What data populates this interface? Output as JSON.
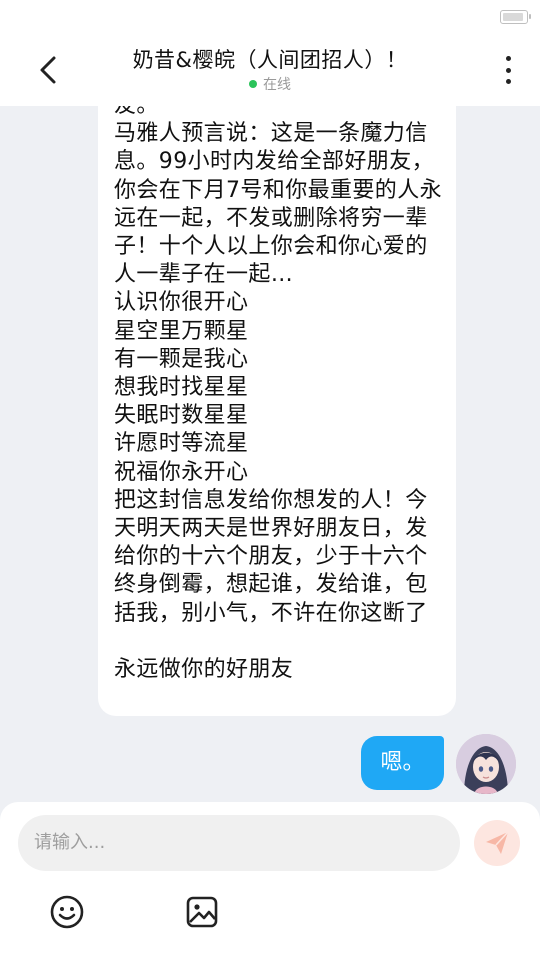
{
  "status_bar": {
    "battery_icon": "battery-icon"
  },
  "header": {
    "back_icon": "chevron-left-icon",
    "title": "奶昔&樱皖（人间团招人）！",
    "status": "在线",
    "status_color": "#2bc35a",
    "more_icon": "more-vertical-icon"
  },
  "messages": {
    "incoming_text": "友。\n马雅人预言说：这是一条魔力信息。99小时内发给全部好朋友，你会在下月7号和你最重要的人永远在一起，不发或删除将穷一辈子！十个人以上你会和你心爱的人一辈子在一起…\n认识你很开心\n星空里万颗星\n有一颗是我心\n想我时找星星\n失眠时数星星\n许愿时等流星\n祝福你永开心\n把这封信息发给你想发的人！今天明天两天是世界好朋友日，发给你的十六个朋友，少于十六个终身倒霉，想起谁，发给谁，包括我，别小气，不许在你这断了\n\n永远做你的好朋友",
    "outgoing_text": "嗯。",
    "outgoing_color": "#1fa8f5"
  },
  "composer": {
    "placeholder": "请输入...",
    "send_icon": "send-icon",
    "emoji_icon": "emoji-icon",
    "image_icon": "image-icon"
  }
}
